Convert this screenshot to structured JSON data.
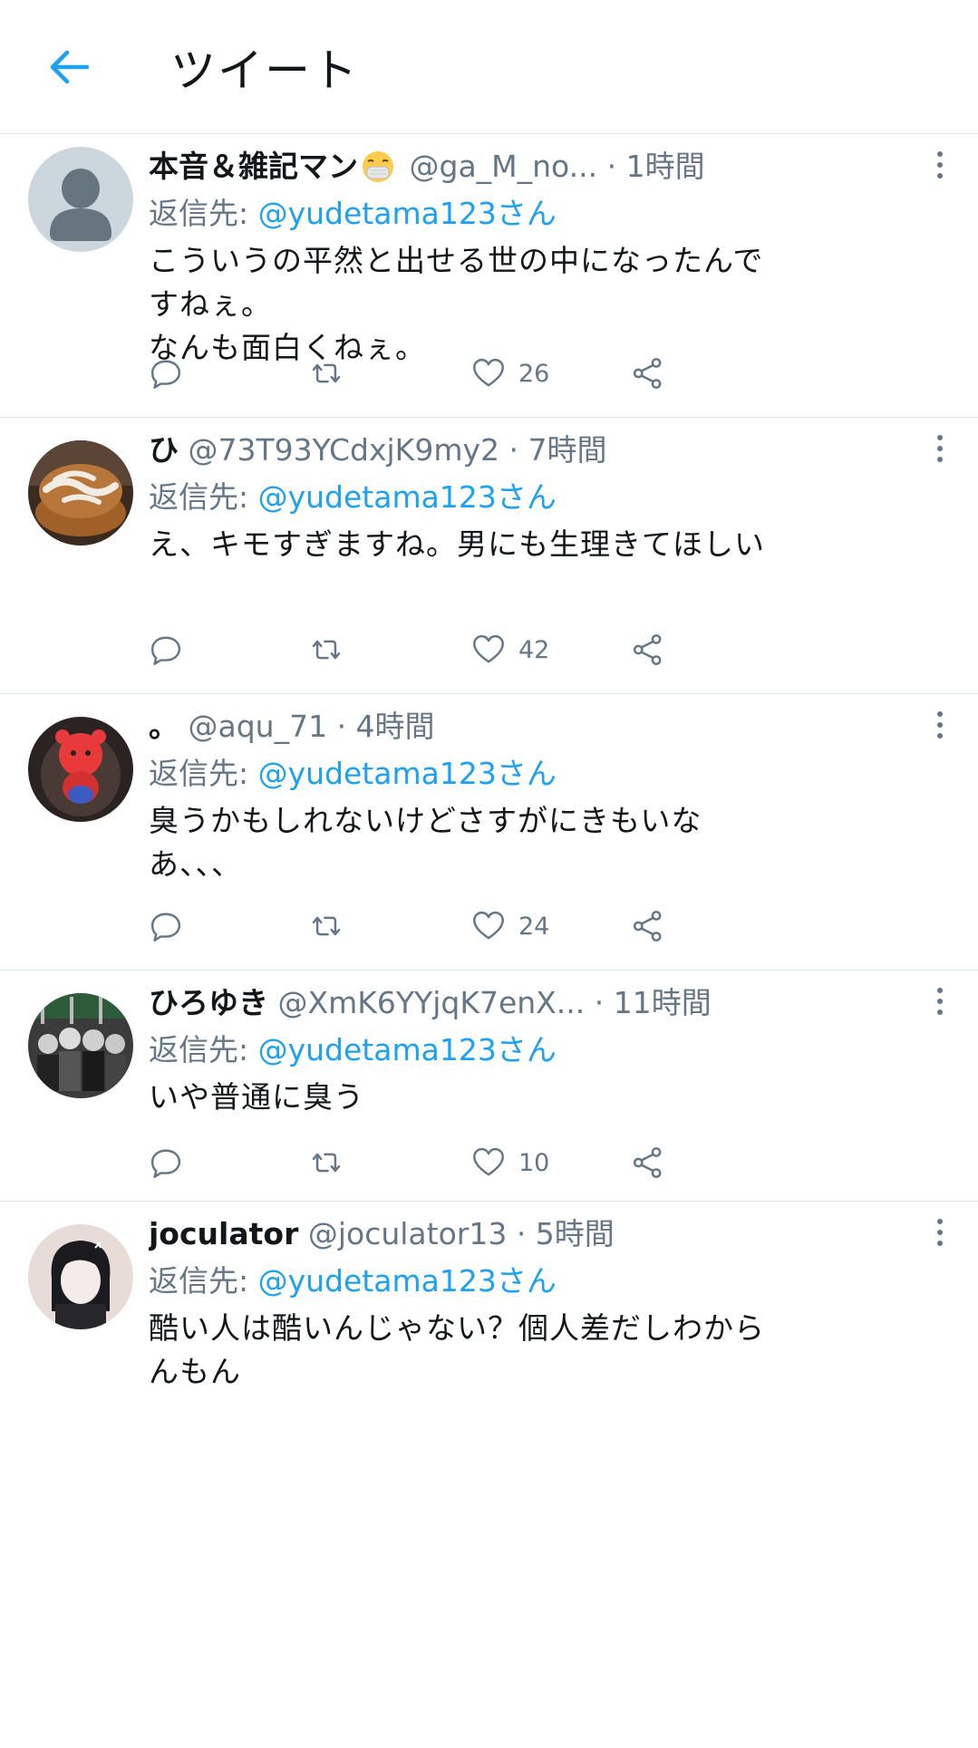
{
  "header": {
    "title": "ツイート"
  },
  "colors": {
    "accent": "#1da1f2",
    "secondary_text": "#657786",
    "divider": "#e1e8ed"
  },
  "tweets": [
    {
      "display_name": "本音＆雑記マン",
      "name_emoji": "face-with-medical-mask",
      "handle_time": "@ga_M_no... · 1時間",
      "reply_prefix": "返信先: ",
      "reply_to": "@yudetama123さん",
      "text": "こういうの平然と出せる世の中になったんですねぇ。\nなんも面白くねぇ。",
      "like_count": "26",
      "avatar": "default-avatar"
    },
    {
      "display_name": "ひ",
      "handle_time": "@73T93YCdxjK9my2 · 7時間",
      "reply_prefix": "返信先: ",
      "reply_to": "@yudetama123さん",
      "text": "え、キモすぎますね。男にも生理きてほしい",
      "like_count": "42",
      "avatar": "cinnamon-roll-photo"
    },
    {
      "display_name": "。",
      "handle_time": "@aqu_71 · 4時間",
      "reply_prefix": "返信先: ",
      "reply_to": "@yudetama123さん",
      "text": "臭うかもしれないけどさすがにきもいなあ、、、",
      "like_count": "24",
      "avatar": "red-bear-plush-photo"
    },
    {
      "display_name": "ひろゆき",
      "handle_time": "@XmK6YYjqK7enX... · 11時間",
      "reply_prefix": "返信先: ",
      "reply_to": "@yudetama123さん",
      "text": "いや普通に臭う",
      "like_count": "10",
      "avatar": "anime-group-image"
    },
    {
      "display_name": "joculator",
      "handle_time": "@joculator13 · 5時間",
      "reply_prefix": "返信先: ",
      "reply_to": "@yudetama123さん",
      "text": "酷い人は酷いんじゃない？個人差だしわからんもん",
      "like_count": "",
      "avatar": "anime-character-portrait"
    }
  ]
}
